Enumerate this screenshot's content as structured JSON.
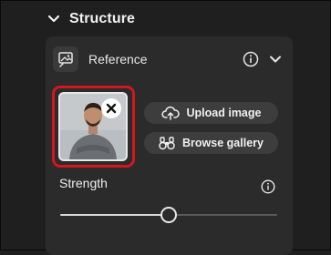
{
  "section": {
    "title": "Structure",
    "expand_icon": "chevron-down-icon"
  },
  "reference": {
    "label": "Reference",
    "icon": "image-reference-icon",
    "info_icon": "info-icon",
    "collapse_icon": "chevron-down-icon",
    "thumbnail_icon": "person-photo",
    "remove_icon": "close-icon"
  },
  "actions": {
    "upload_label": "Upload image",
    "upload_icon": "cloud-upload-icon",
    "browse_label": "Browse gallery",
    "browse_icon": "binoculars-icon"
  },
  "strength": {
    "label": "Strength",
    "info_icon": "info-icon",
    "value_fraction": 0.5
  },
  "colors": {
    "highlight": "#d4161e",
    "panel": "#2b2b2b",
    "background": "#1f1f1f"
  }
}
